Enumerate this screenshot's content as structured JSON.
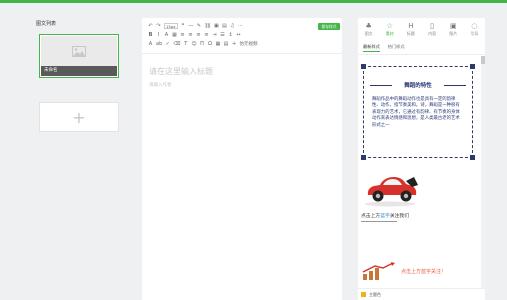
{
  "left": {
    "title": "图文列表",
    "article_label": "未命名",
    "add_label": "+"
  },
  "toolbar": {
    "save_label": "保存样式",
    "font_size": "15px",
    "extra_label": "仿元视频"
  },
  "editor": {
    "title_placeholder": "请在这里输入标题",
    "author_placeholder": "请输入作者"
  },
  "right": {
    "tabs": [
      {
        "label": "图文",
        "icon": "article-icon"
      },
      {
        "label": "素材",
        "icon": "star-icon"
      },
      {
        "label": "标题",
        "icon": "heading-icon"
      },
      {
        "label": "内容",
        "icon": "document-icon"
      },
      {
        "label": "图片",
        "icon": "image-icon"
      },
      {
        "label": "引导",
        "icon": "chat-icon"
      }
    ],
    "subtabs": [
      "最新样式",
      "热门样式"
    ],
    "template": {
      "title": "舞蹈的特性",
      "body": "舞蹈作品中的舞蹈动作也是具有一定的韵律性、动作，指节奏美和。诗，舞蹈是一种很有表现力的艺术，它通过有韵律、有节奏的身体动作来表达情感和思想，是人类最古老的艺术形式之一"
    },
    "follow_text_a": "点击上方",
    "follow_text_b": "蓝字",
    "follow_text_c": "关注我们",
    "promo_text": "点击上方蓝字关注！",
    "bottom_label": "主题色",
    "colors": {
      "accent": "#44b549",
      "navy": "#2e3a6e",
      "promo": "#e85d3a",
      "yellow": "#f0b21a"
    }
  }
}
